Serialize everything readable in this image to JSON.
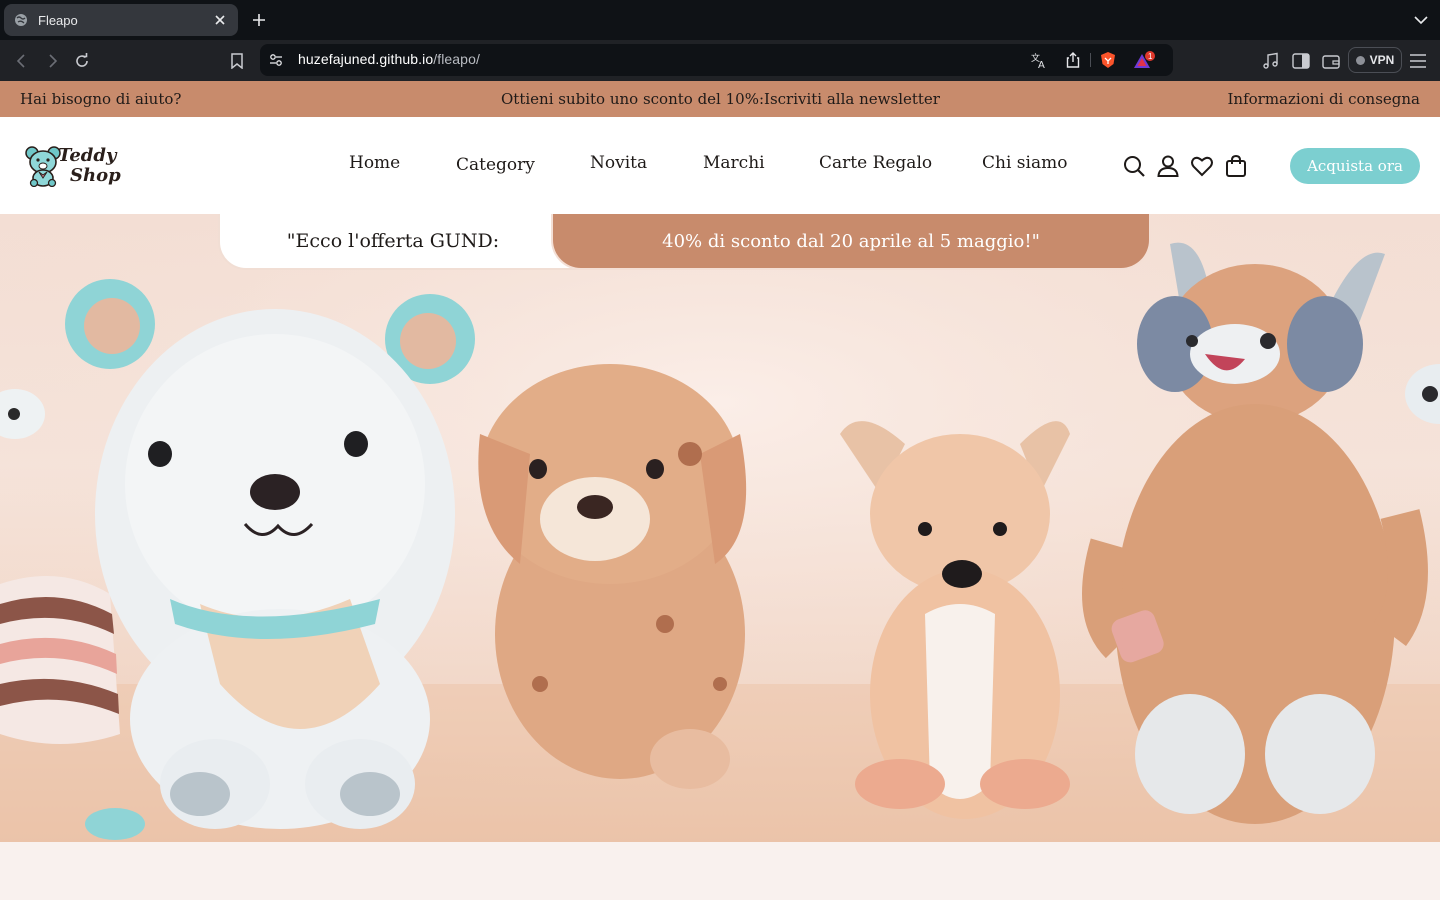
{
  "browser": {
    "tab_title": "Fleapo",
    "url_host": "huzefajuned.github.io",
    "url_path": "/fleapo/",
    "notification_count": "1",
    "vpn_label": "VPN"
  },
  "announcement": {
    "help": "Hai bisogno di aiuto?",
    "promo": "Ottieni subito uno sconto del 10%:Iscriviti alla newsletter",
    "delivery": "Informazioni di consegna"
  },
  "header": {
    "logo_line1": "Teddy",
    "logo_line2": "Shop",
    "nav": [
      "Home",
      "Category",
      "Novita",
      "Marchi",
      "Carte Regalo",
      "Chi siamo"
    ],
    "cta": "Acquista ora"
  },
  "offer": {
    "intro": "\"Ecco l'offerta GUND:",
    "detail": "40% di sconto dal 20 aprile al 5 maggio!\""
  },
  "colors": {
    "brand": "#c88b6c",
    "accent": "#7ccfd0",
    "chrome_dark": "#0f1216"
  },
  "icons": [
    "globe-icon",
    "close-icon",
    "plus-icon",
    "chevron-down-icon",
    "back-icon",
    "forward-icon",
    "reload-icon",
    "bookmark-icon",
    "site-settings-icon",
    "translate-icon",
    "share-icon",
    "brave-shield-icon",
    "brave-rewards-icon",
    "media-icon",
    "sidebar-icon",
    "wallet-icon",
    "menu-icon",
    "search-icon",
    "user-icon",
    "heart-icon",
    "cart-icon"
  ]
}
